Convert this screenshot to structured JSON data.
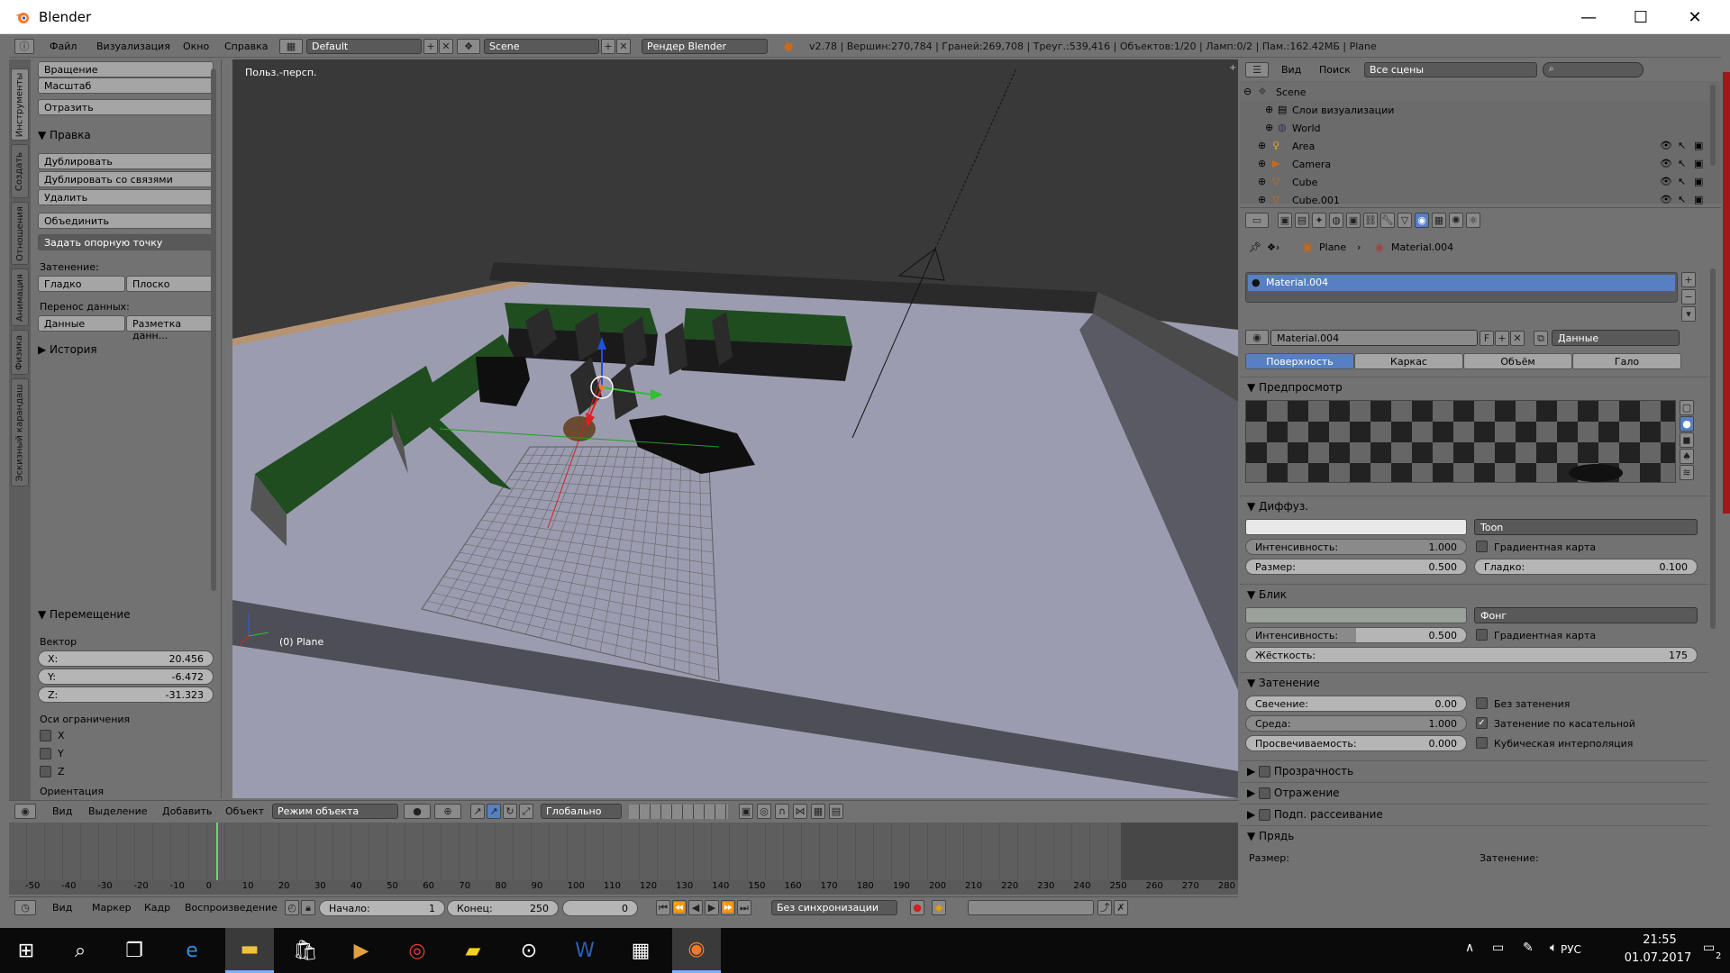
{
  "window": {
    "title": "Blender",
    "min": "—",
    "max": "☐",
    "close": "✕"
  },
  "info_header": {
    "menus": [
      "Файл",
      "Визуализация",
      "Окно",
      "Справка"
    ],
    "layout": "Default",
    "scene": "Scene",
    "engine": "Рендер Blender",
    "stats": "v2.78 | Вершин:270,784 | Граней:269,708 | Треуг.:539,416 | Объектов:1/20 | Ламп:0/2 | Пам.:162.42МБ | Plane"
  },
  "left_tabs": [
    "Инструменты",
    "Создать",
    "Отношения",
    "Анимация",
    "Физика",
    "Эскизный карандаш"
  ],
  "toolshelf": {
    "rotate": "Вращение",
    "scale": "Масштаб",
    "mirror": "Отразить",
    "edit_header": "Правка",
    "duplicate": "Дублировать",
    "duplicate_linked": "Дублировать со связями",
    "delete": "Удалить",
    "join": "Объединить",
    "set_origin": "Задать опорную точку",
    "shading_label": "Затенение:",
    "smooth": "Гладко",
    "flat": "Плоско",
    "data_transfer_label": "Перенос данных:",
    "data": "Данные",
    "layout_data": "Разметка данн...",
    "history": "История",
    "move_header": "Перемещение",
    "vector_label": "Вектор",
    "x_label": "X:",
    "x": "20.456",
    "y_label": "Y:",
    "y": "-6.472",
    "z_label": "Z:",
    "z": "-31.323",
    "constraint_label": "Оси ограничения",
    "cx": "X",
    "cy": "Y",
    "cz": "Z",
    "orientation": "Ориентация"
  },
  "viewport": {
    "view_label": "Польз.-персп.",
    "object_label": "(0) Plane"
  },
  "vp_header": {
    "view": "Вид",
    "select": "Выделение",
    "add": "Добавить",
    "object": "Объект",
    "mode": "Режим объекта",
    "orientation": "Глобально"
  },
  "timeline": {
    "ticks": [
      "-50",
      "-40",
      "-30",
      "-20",
      "-10",
      "0",
      "10",
      "20",
      "30",
      "40",
      "50",
      "60",
      "70",
      "80",
      "90",
      "100",
      "110",
      "120",
      "130",
      "140",
      "150",
      "160",
      "170",
      "180",
      "190",
      "200",
      "210",
      "220",
      "230",
      "240",
      "250",
      "260",
      "270",
      "280"
    ],
    "view": "Вид",
    "marker": "Маркер",
    "frame": "Кадр",
    "playback": "Воспроизведение",
    "start_label": "Начало:",
    "start": "1",
    "end_label": "Конец:",
    "end": "250",
    "current": "0",
    "sync": "Без синхронизации"
  },
  "outliner": {
    "view": "Вид",
    "search": "Поиск",
    "filter": "Все сцены",
    "rows": [
      "Scene",
      "Слои визуализации",
      "World",
      "Area",
      "Camera",
      "Cube",
      "Cube.001"
    ]
  },
  "properties": {
    "breadcrumb_obj": "Plane",
    "breadcrumb_mat": "Material.004",
    "slot": "Material.004",
    "material_name": "Material.004",
    "fake_user": "F",
    "link": "Данные",
    "tabs": [
      "Поверхность",
      "Каркас",
      "Объём",
      "Гало"
    ],
    "preview_header": "Предпросмотр",
    "diffuse_header": "Диффуз.",
    "diffuse_shader": "Toon",
    "intensity_label": "Интенсивность:",
    "diffuse_intensity": "1.000",
    "ramp": "Градиентная карта",
    "size_label": "Размер:",
    "size": "0.500",
    "smooth_label": "Гладко:",
    "smooth": "0.100",
    "specular_header": "Блик",
    "specular_shader": "Фонг",
    "spec_intensity": "0.500",
    "hardness_label": "Жёсткость:",
    "hardness": "175",
    "shading_header": "Затенение",
    "emit_label": "Свечение:",
    "emit": "0.00",
    "shadeless": "Без затенения",
    "ambient_label": "Среда:",
    "ambient": "1.000",
    "tangent": "Затенение по касательной",
    "translucency_label": "Просвечиваемость:",
    "translucency": "0.000",
    "cubic": "Кубическая интерполяция",
    "transparency": "Прозрачность",
    "mirror": "Отражение",
    "sss": "Подп. рассеивание",
    "strand": "Прядь",
    "strand_size": "Размер:",
    "strand_shading": "Затенение:"
  },
  "taskbar": {
    "lang": "РУС",
    "time": "21:55",
    "date": "01.07.2017",
    "notif": "2"
  },
  "colors": {
    "accent_blue": "#5680c2",
    "grass_green": "#1f4d1f",
    "floor": "#9c9cb0"
  }
}
